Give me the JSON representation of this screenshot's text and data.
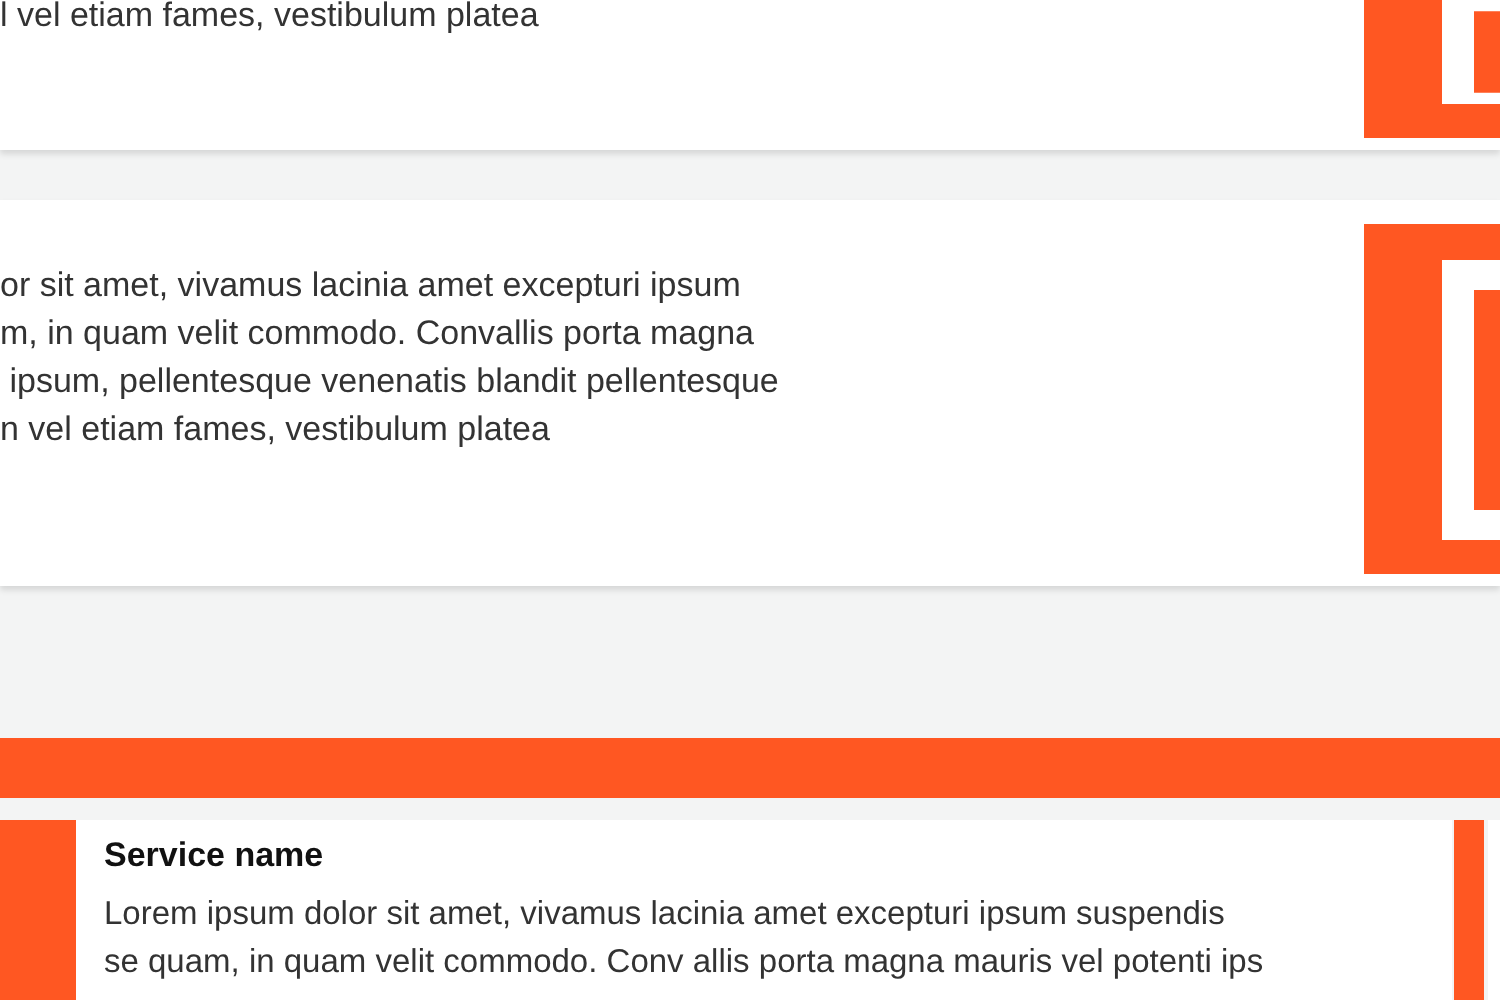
{
  "cards": [
    {
      "lines": [
        "l vel etiam fames, vestibulum platea"
      ]
    },
    {
      "lines": [
        "or sit amet, vivamus lacinia amet excepturi ipsum",
        "m, in quam velit commodo. Convallis porta magna",
        " ipsum, pellentesque venenatis blandit pellentesque",
        "n vel etiam fames, vestibulum platea"
      ]
    }
  ],
  "service": {
    "title": "Service name",
    "lines": [
      "Lorem ipsum dolor sit amet, vivamus lacinia amet excepturi ipsum suspendis",
      "se quam, in quam velit commodo. Conv allis porta magna mauris vel potenti ips"
    ]
  }
}
